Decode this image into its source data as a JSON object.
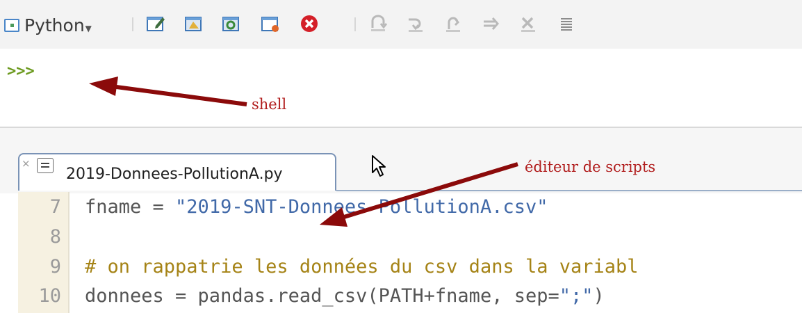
{
  "toolbar": {
    "language": "Python",
    "buttons": [
      {
        "icon": "new-file-icon"
      },
      {
        "icon": "open-file-icon"
      },
      {
        "icon": "reload-icon"
      },
      {
        "icon": "save-icon"
      },
      {
        "icon": "stop-icon"
      },
      {
        "icon": "step-into-icon"
      },
      {
        "icon": "step-over-icon"
      },
      {
        "icon": "step-out-icon"
      },
      {
        "icon": "continue-icon"
      },
      {
        "icon": "clear-breakpoints-icon"
      },
      {
        "icon": "list-icon"
      }
    ]
  },
  "shell": {
    "prompt": ">>>"
  },
  "editor": {
    "tab": {
      "close": "×",
      "filename": "2019-Donnees-PollutionA.py"
    },
    "lines": [
      {
        "num": "7",
        "pre": "fname = ",
        "str": "\"2019-SNT-Donnees-PollutionA.csv\"",
        "cmt": "",
        "post": ""
      },
      {
        "num": "8",
        "pre": "",
        "str": "",
        "cmt": "",
        "post": ""
      },
      {
        "num": "9",
        "pre": "",
        "str": "",
        "cmt": "# on rappatrie les données du csv dans la variabl",
        "post": ""
      },
      {
        "num": "10",
        "pre": "donnees = pandas.read_csv(PATH+fname, sep=",
        "str": "\";\"",
        "cmt": "",
        "post": ")"
      }
    ]
  },
  "annotations": {
    "shell": "shell",
    "editor": "éditeur de scripts",
    "color": "#8b0a0a"
  }
}
